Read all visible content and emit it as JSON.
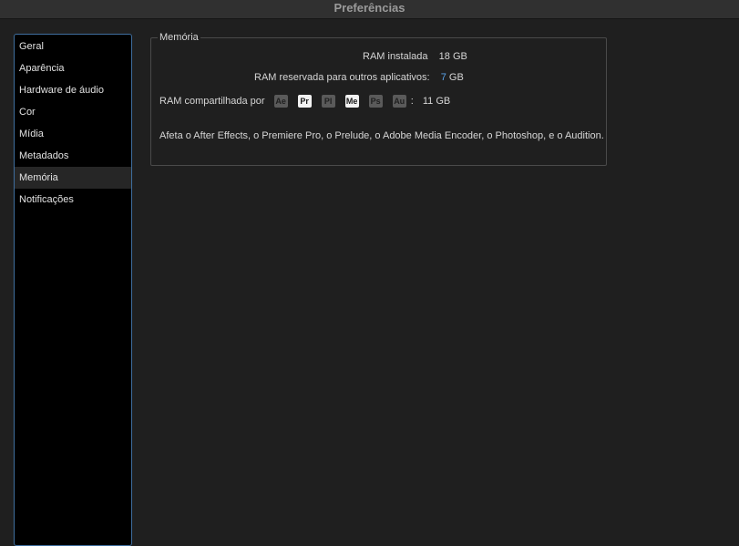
{
  "window": {
    "title": "Preferências"
  },
  "sidebar": {
    "items": [
      {
        "label": "Geral",
        "selected": false
      },
      {
        "label": "Aparência",
        "selected": false
      },
      {
        "label": "Hardware de áudio",
        "selected": false
      },
      {
        "label": "Cor",
        "selected": false
      },
      {
        "label": "Mídia",
        "selected": false
      },
      {
        "label": "Metadados",
        "selected": false
      },
      {
        "label": "Memória",
        "selected": true
      },
      {
        "label": "Notificações",
        "selected": false
      }
    ]
  },
  "memory": {
    "group_label": "Memória",
    "installed_label": "RAM instalada",
    "installed_value": "18 GB",
    "reserved_label": "RAM reservada para outros aplicativos:",
    "reserved_value": "7",
    "reserved_unit": "GB",
    "shared_label": "RAM compartilhada por",
    "apps": [
      {
        "abbr": "Ae",
        "active": false
      },
      {
        "abbr": "Pr",
        "active": true
      },
      {
        "abbr": "Pl",
        "active": false
      },
      {
        "abbr": "Me",
        "active": true
      },
      {
        "abbr": "Ps",
        "active": false
      },
      {
        "abbr": "Au",
        "active": false
      }
    ],
    "shared_separator": ":",
    "shared_value": "11 GB",
    "note": "Afeta o After Effects, o Premiere Pro, o Prelude, o Adobe Media Encoder, o Photoshop, e o Audition."
  },
  "colors": {
    "accent": "#5aa3e8",
    "sidebar_border": "#3f6e9e"
  }
}
